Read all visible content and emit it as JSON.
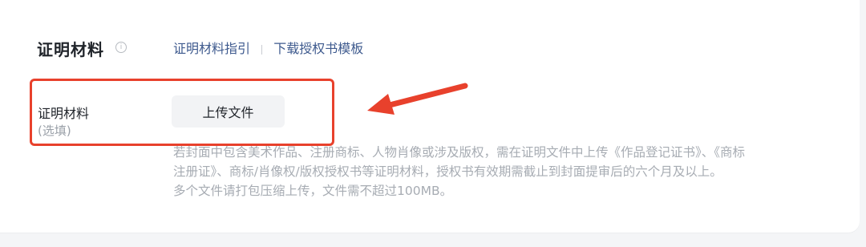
{
  "section": {
    "title": "证明材料",
    "info_icon": "info-icon",
    "links": [
      "证明材料指引",
      "下载授权书模板"
    ]
  },
  "field": {
    "label": "证明材料",
    "optional": "(选填)",
    "upload_button": "上传文件"
  },
  "hints": [
    "若封面中包含美术作品、注册商标、人物肖像或涉及版权，需在证明文件中上传《作品登记证书》、《商标",
    "注册证》、商标/肖像权/版权授权书等证明材料，授权书有效期需截止到封面提审后的六个月及以上。",
    "多个文件请打包压缩上传，文件需不超过100MB。"
  ],
  "colors": {
    "highlight": "#e8412c",
    "link": "#3e5a8e",
    "hint_text": "#a7acb3"
  }
}
